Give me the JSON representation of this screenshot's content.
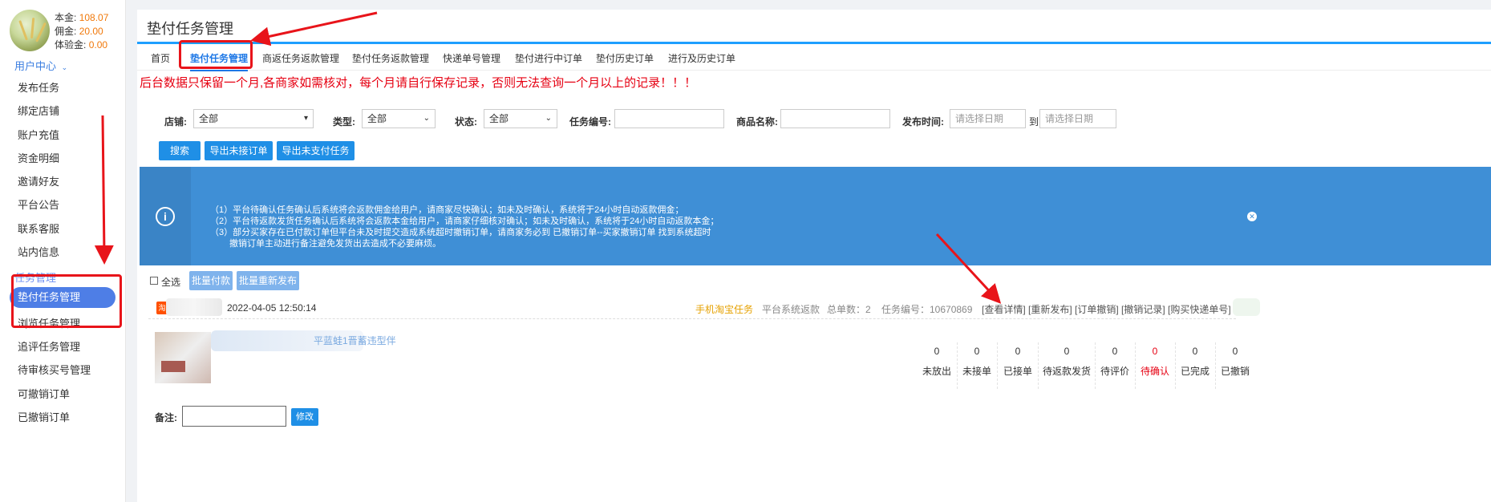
{
  "profile": {
    "balance_label": "本金:",
    "balance_value": "108.07",
    "commission_label": "佣金:",
    "commission_value": "20.00",
    "trial_label": "体验金:",
    "trial_value": "0.00"
  },
  "sidebar": {
    "user_center": "用户中心",
    "items": [
      "发布任务",
      "绑定店铺",
      "账户充值",
      "资金明细",
      "邀请好友",
      "平台公告",
      "联系客服",
      "站内信息"
    ],
    "task_group": "任务管理",
    "task_items": [
      "垫付任务管理",
      "浏览任务管理",
      "追评任务管理",
      "待审核买号管理",
      "可撤销订单",
      "已撤销订单"
    ]
  },
  "panel": {
    "title": "垫付任务管理"
  },
  "tabs": [
    "首页",
    "垫付任务管理",
    "商返任务返款管理",
    "垫付任务返款管理",
    "快递单号管理",
    "垫付进行中订单",
    "垫付历史订单",
    "进行及历史订单"
  ],
  "notice": "后台数据只保留一个月,各商家如需核对，每个月请自行保存记录，否则无法查询一个月以上的记录！！！",
  "filters": {
    "shop_label": "店铺:",
    "shop_value": "全部",
    "type_label": "类型:",
    "type_value": "全部",
    "status_label": "状态:",
    "status_value": "全部",
    "task_no_label": "任务编号:",
    "product_label": "商品名称:",
    "time_label": "发布时间:",
    "date_placeholder": "请选择日期",
    "to": "到"
  },
  "buttons": {
    "search": "搜索",
    "export_unaccepted": "导出未接订单",
    "export_unpaid": "导出未支付任务"
  },
  "info": {
    "line1": "（1）平台待确认任务确认后系统将会返款佣金给用户，请商家尽快确认；如未及时确认，系统将于24小时自动返款佣金；",
    "line2": "（2）平台待返款发货任务确认后系统将会返款本金给用户，请商家仔细核对确认；如未及时确认，系统将于24小时自动返款本金；",
    "line3": "（3）部分买家存在已付款订单但平台未及时提交造成系统超时撤销订单，请商家务必到 已撤销订单--买家撤销订单 找到系统超时",
    "line4": "撤销订单主动进行备注避免发货出去造成不必要麻烦。"
  },
  "batch": {
    "select_all": "全选",
    "batch_pay": "批量付款",
    "batch_republish": "批量重新发布"
  },
  "order": {
    "badge": "淘",
    "time": "2022-04-05 12:50:14",
    "task_type": "手机淘宝任务",
    "refund": "平台系统返款",
    "total": "总单数：2",
    "task_no": "任务编号：10670869",
    "actions": "[查看详情] [重新发布] [订单撤销] [撤销记录] [购买快递单号]",
    "product_link": "平蓝蛙1晋蓄违型伴",
    "stats": [
      {
        "value": "0",
        "label": "未放出"
      },
      {
        "value": "0",
        "label": "未接单"
      },
      {
        "value": "0",
        "label": "已接单"
      },
      {
        "value": "0",
        "label": "待返款发货"
      },
      {
        "value": "0",
        "label": "待评价"
      },
      {
        "value": "0",
        "label": "待确认",
        "highlight": true
      },
      {
        "value": "0",
        "label": "已完成"
      },
      {
        "value": "0",
        "label": "已撤销"
      }
    ],
    "remark_label": "备注:",
    "modify": "修改"
  },
  "colors": {
    "accent": "#1e9fff",
    "annotation": "#e8141a",
    "warning": "#e60012"
  }
}
